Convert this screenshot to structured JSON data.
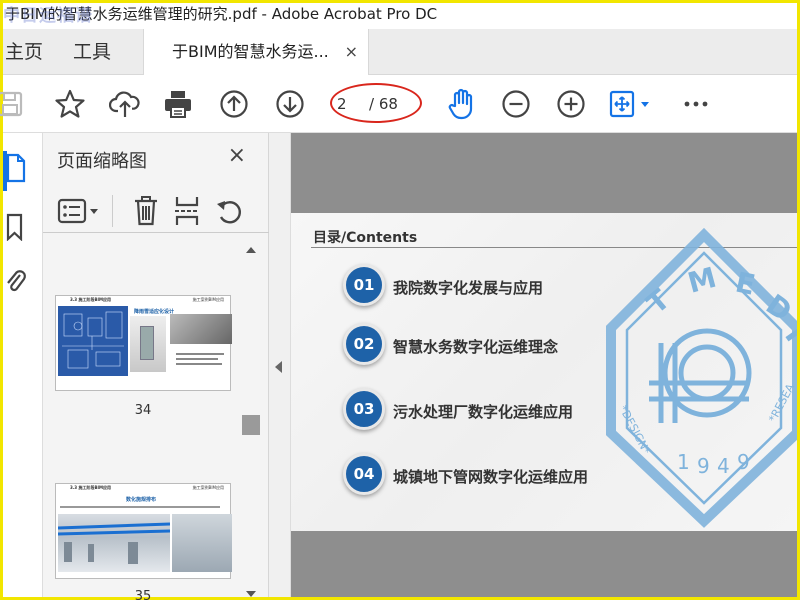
{
  "window": {
    "title": "于BIM的智慧水务运维管理的研究.pdf - Adobe Acrobat Pro DC",
    "watermark": "中日运福谱"
  },
  "tabs": {
    "home": "主页",
    "tools": "工具",
    "document": "于BIM的智慧水务运...",
    "close": "×"
  },
  "toolbar": {
    "current_page": "2",
    "total_pages": "/ 68"
  },
  "thumbnail_panel": {
    "title": "页面缩略图",
    "close": "×",
    "thumbnails": [
      {
        "label": "34",
        "header": "3.3 施工阶段BIM应用",
        "subheader": "施工案例BIM应用",
        "caption": "降雨雪适应化设计"
      },
      {
        "label": "35",
        "header": "3.3 施工阶段BIM应用",
        "subheader": "施工案例BIM应用",
        "caption": "数化施规排布"
      }
    ]
  },
  "document_page": {
    "contents_title": "目录/Contents",
    "items": [
      {
        "number": "01",
        "text": "我院数字化发展与应用"
      },
      {
        "number": "02",
        "text": "智慧水务数字化运维理念"
      },
      {
        "number": "03",
        "text": "污水处理厂数字化运维应用"
      },
      {
        "number": "04",
        "text": "城镇地下管网数字化运维应用"
      }
    ],
    "logo": {
      "letters": "TMEDI",
      "year": "1949",
      "left_text": "DESIGN",
      "right_text": "RESEA"
    }
  },
  "colors": {
    "accent_blue": "#1e62a8",
    "annotation_red": "#d9261c",
    "logo_blue": "#7fb3dc"
  }
}
